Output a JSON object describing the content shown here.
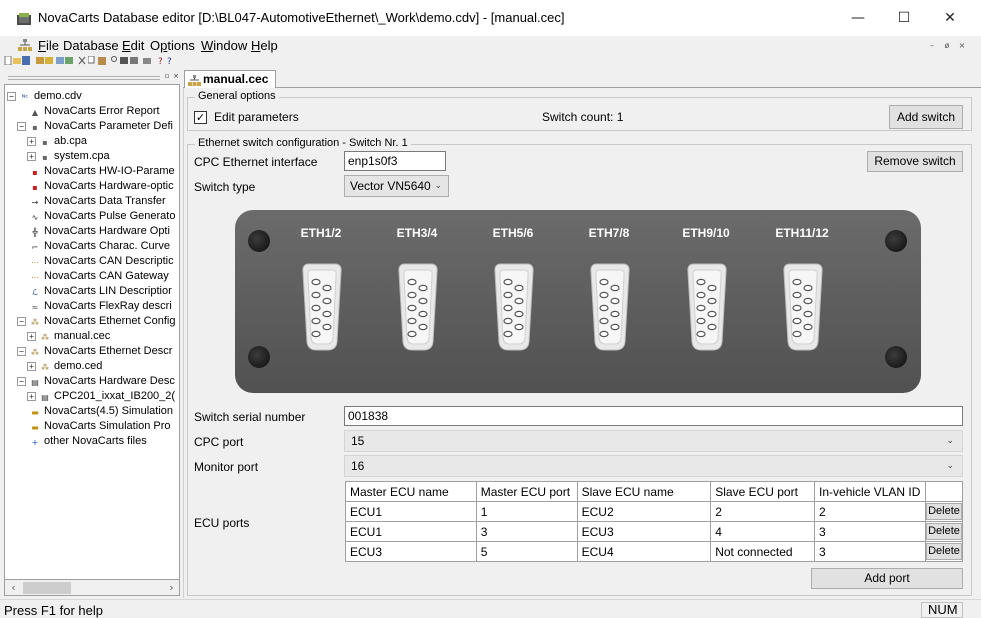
{
  "window": {
    "title": "NovaCarts Database editor [D:\\BL047-AutomotiveEthernet\\_Work\\demo.cdv] - [manual.cec]",
    "minimize": "—",
    "maximize": "☐",
    "close": "✕"
  },
  "menu": {
    "file": "File",
    "database": "Database",
    "edit": "Edit",
    "options": "Options",
    "window": "Window",
    "help": "Help",
    "mdi_min": "–",
    "mdi_restore": "ø",
    "mdi_close": "×"
  },
  "tree": {
    "items": [
      {
        "label": "demo.cdv",
        "icon": "NC"
      },
      {
        "label": "NovaCarts Error Report",
        "icon": "doc"
      },
      {
        "label": "NovaCarts Parameter Defi",
        "icon": "ipa"
      },
      {
        "label": "ab.cpa",
        "icon": "ipa"
      },
      {
        "label": "system.cpa",
        "icon": "ipa"
      },
      {
        "label": "NovaCarts HW-IO-Parame",
        "icon": "red"
      },
      {
        "label": "NovaCarts Hardware-optic",
        "icon": "red"
      },
      {
        "label": "NovaCarts Data Transfer",
        "icon": "arrow"
      },
      {
        "label": "NovaCarts Pulse Generato",
        "icon": "pulse"
      },
      {
        "label": "NovaCarts Hardware Opti",
        "icon": "hw"
      },
      {
        "label": "NovaCarts Charac. Curve",
        "icon": "curve"
      },
      {
        "label": "NovaCarts CAN Descriptic",
        "icon": "can"
      },
      {
        "label": "NovaCarts CAN Gateway",
        "icon": "can"
      },
      {
        "label": "NovaCarts LIN Descriptior",
        "icon": "lin"
      },
      {
        "label": "NovaCarts FlexRay descri",
        "icon": "fr"
      },
      {
        "label": "NovaCarts Ethernet Config",
        "icon": "eth"
      },
      {
        "label": "manual.cec",
        "icon": "eth"
      },
      {
        "label": "NovaCarts Ethernet Descr",
        "icon": "eth"
      },
      {
        "label": "demo.ced",
        "icon": "eth"
      },
      {
        "label": "NovaCarts Hardware Desc",
        "icon": "hwd"
      },
      {
        "label": "CPC201_ixxat_IB200_2(",
        "icon": "hwd"
      },
      {
        "label": "NovaCarts(4.5) Simulation",
        "icon": "sim"
      },
      {
        "label": "NovaCarts Simulation Pro",
        "icon": "sim"
      },
      {
        "label": "other NovaCarts files",
        "icon": "plus"
      }
    ]
  },
  "tab": {
    "label": "manual.cec"
  },
  "general": {
    "title": "General options",
    "edit_parameters": "Edit parameters",
    "checkbox_mark": "✓",
    "switch_count": "Switch count: 1",
    "add_switch": "Add switch"
  },
  "switch_cfg": {
    "title": "Ethernet switch configuration - Switch Nr. 1",
    "cpc_iface_label": "CPC Ethernet interface",
    "cpc_iface_value": "enp1s0f3",
    "remove_switch": "Remove switch",
    "switch_type_label": "Switch type",
    "switch_type_value": "Vector VN5640",
    "ports": [
      "ETH1/2",
      "ETH3/4",
      "ETH5/6",
      "ETH7/8",
      "ETH9/10",
      "ETH11/12"
    ],
    "serial_label": "Switch serial number",
    "serial_value": "001838",
    "cpc_port_label": "CPC port",
    "cpc_port_value": "15",
    "monitor_port_label": "Monitor port",
    "monitor_port_value": "16",
    "ecu_ports_label": "ECU ports"
  },
  "ecu_table": {
    "headers": [
      "Master ECU name",
      "Master ECU port",
      "Slave ECU name",
      "Slave ECU port",
      "In-vehicle VLAN ID"
    ],
    "rows": [
      [
        "ECU1",
        "1",
        "ECU2",
        "2",
        "2"
      ],
      [
        "ECU1",
        "3",
        "ECU3",
        "4",
        "3"
      ],
      [
        "ECU3",
        "5",
        "ECU4",
        "Not connected",
        "3"
      ]
    ],
    "delete_label": "Delete",
    "add_port": "Add port"
  },
  "status": {
    "help_text": "Press F1 for help",
    "num": "NUM"
  },
  "colors": {
    "panel_dark": "#5e5e5e",
    "connector_white": "#e8e8e8"
  }
}
